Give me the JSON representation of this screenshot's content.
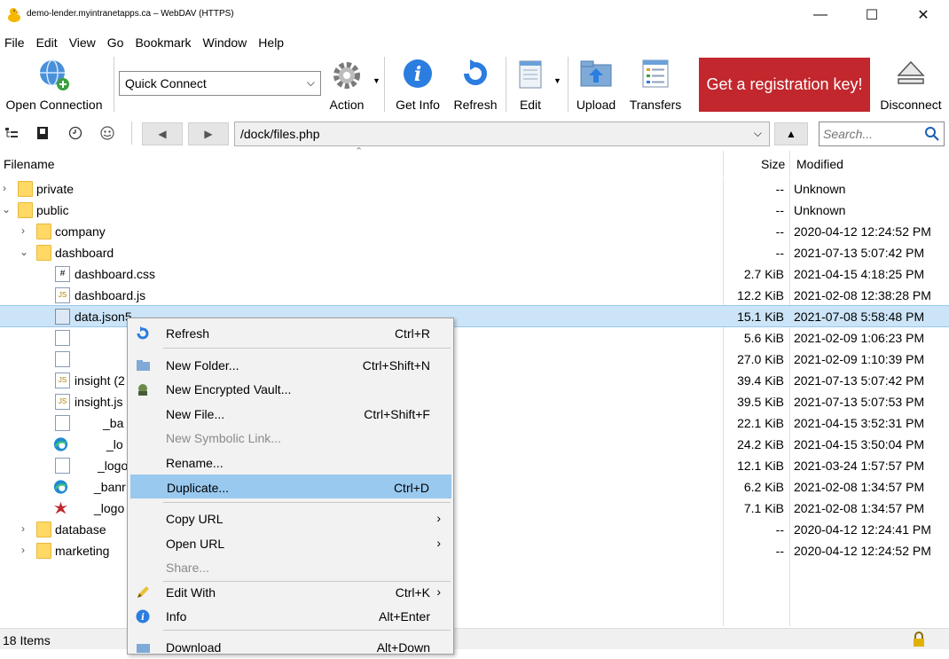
{
  "window": {
    "title": "demo-lender.myintranetapps.ca – WebDAV (HTTPS)",
    "minimize": "—",
    "maximize": "☐",
    "close": "✕"
  },
  "menu": [
    "File",
    "Edit",
    "View",
    "Go",
    "Bookmark",
    "Window",
    "Help"
  ],
  "toolbar": {
    "open_connection": "Open Connection",
    "quick_connect": "Quick Connect",
    "action": "Action",
    "get_info": "Get Info",
    "refresh": "Refresh",
    "edit": "Edit",
    "upload": "Upload",
    "transfers": "Transfers",
    "registration": "Get a registration key!",
    "disconnect": "Disconnect"
  },
  "pathbar": {
    "path": "/dock/files.php",
    "search_placeholder": "Search..."
  },
  "columns": {
    "filename": "Filename",
    "size": "Size",
    "modified": "Modified"
  },
  "files": [
    {
      "name": "private",
      "size": "--",
      "modified": "Unknown"
    },
    {
      "name": "public",
      "size": "--",
      "modified": "Unknown"
    },
    {
      "name": "company",
      "size": "--",
      "modified": "2020-04-12 12:24:52 PM"
    },
    {
      "name": "dashboard",
      "size": "--",
      "modified": "2021-07-13 5:07:42 PM"
    },
    {
      "name": "dashboard.css",
      "size": "2.7 KiB",
      "modified": "2021-04-15 4:18:25 PM"
    },
    {
      "name": "dashboard.js",
      "size": "12.2 KiB",
      "modified": "2021-02-08 12:38:28 PM"
    },
    {
      "name": "data.json5",
      "size": "15.1 KiB",
      "modified": "2021-07-08 5:58:48 PM"
    },
    {
      "name": "",
      "size": "5.6 KiB",
      "modified": "2021-02-09 1:06:23 PM"
    },
    {
      "name": "",
      "size": "27.0 KiB",
      "modified": "2021-02-09 1:10:39 PM"
    },
    {
      "name": "insight (2",
      "size": "39.4 KiB",
      "modified": "2021-07-13 5:07:42 PM"
    },
    {
      "name": "insight.js",
      "size": "39.5 KiB",
      "modified": "2021-07-13 5:07:53 PM"
    },
    {
      "name": "_ba",
      "size": "22.1 KiB",
      "modified": "2021-04-15 3:52:31 PM"
    },
    {
      "name": "_lo",
      "size": "24.2 KiB",
      "modified": "2021-04-15 3:50:04 PM"
    },
    {
      "name": "_logo",
      "size": "12.1 KiB",
      "modified": "2021-03-24 1:57:57 PM"
    },
    {
      "name": "_banr",
      "size": "6.2 KiB",
      "modified": "2021-02-08 1:34:57 PM"
    },
    {
      "name": "_logo",
      "size": "7.1 KiB",
      "modified": "2021-02-08 1:34:57 PM"
    },
    {
      "name": "database",
      "size": "--",
      "modified": "2020-04-12 12:24:41 PM"
    },
    {
      "name": "marketing",
      "size": "--",
      "modified": "2020-04-12 12:24:52 PM"
    }
  ],
  "context_menu": [
    {
      "label": "Refresh",
      "shortcut": "Ctrl+R"
    },
    {
      "label": "New Folder...",
      "shortcut": "Ctrl+Shift+N"
    },
    {
      "label": "New Encrypted Vault...",
      "shortcut": ""
    },
    {
      "label": "New File...",
      "shortcut": "Ctrl+Shift+F"
    },
    {
      "label": "New Symbolic Link...",
      "shortcut": ""
    },
    {
      "label": "Rename...",
      "shortcut": ""
    },
    {
      "label": "Duplicate...",
      "shortcut": "Ctrl+D"
    },
    {
      "label": "Copy URL",
      "shortcut": ""
    },
    {
      "label": "Open URL",
      "shortcut": ""
    },
    {
      "label": "Share...",
      "shortcut": ""
    },
    {
      "label": "Edit With",
      "shortcut": "Ctrl+K"
    },
    {
      "label": "Info",
      "shortcut": "Alt+Enter"
    },
    {
      "label": "Download",
      "shortcut": "Alt+Down"
    }
  ],
  "status": {
    "items": "18 Items"
  },
  "colors": {
    "selection": "#cce4f7",
    "highlight": "#99c9ef",
    "registration_bg": "#c1272d"
  }
}
